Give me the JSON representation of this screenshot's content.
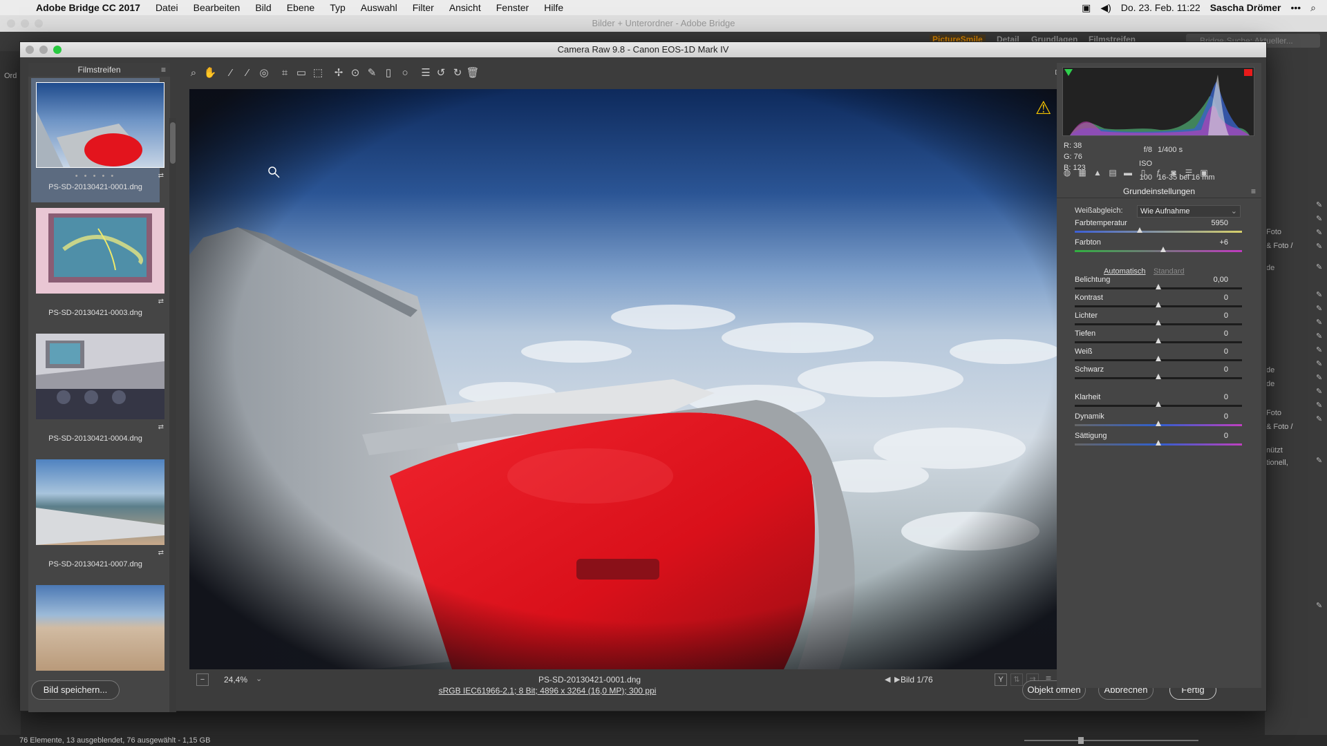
{
  "menubar": {
    "app_name": "Adobe Bridge CC 2017",
    "items": [
      "Datei",
      "Bearbeiten",
      "Bild",
      "Ebene",
      "Typ",
      "Auswahl",
      "Filter",
      "Ansicht",
      "Fenster",
      "Hilfe"
    ],
    "datetime": "Do. 23. Feb. 11:22",
    "user": "Sascha Drömer"
  },
  "bridge": {
    "window_title": "Bilder + Unterordner - Adobe Bridge",
    "workspaces": [
      "PictureSmile",
      "Detail",
      "Grundlagen",
      "Filmstreifen"
    ],
    "search_placeholder": "Bridge-Suche: Aktueller...",
    "left_panel_label": "Ord",
    "right_fragments": [
      "Foto",
      "& Foto /",
      "de",
      "de",
      "de",
      "Foto",
      "& Foto /",
      "nützt",
      "tionell,"
    ],
    "status": "76 Elemente, 13 ausgeblendet, 76 ausgewählt - 1,15 GB"
  },
  "dialog": {
    "title": "Camera Raw 9.8 - Canon EOS-1D Mark IV",
    "filmstrip": {
      "title": "Filmstreifen",
      "items": [
        {
          "name": "PS-SD-20130421-0001.dng",
          "dots": "• • • • •"
        },
        {
          "name": "PS-SD-20130421-0003.dng"
        },
        {
          "name": "PS-SD-20130421-0004.dng"
        },
        {
          "name": "PS-SD-20130421-0007.dng"
        },
        {
          "name": ""
        }
      ]
    },
    "preview": {
      "zoom": "24,4%",
      "filename": "PS-SD-20130421-0001.dng",
      "nav": "Bild 1/76"
    },
    "info_link": "sRGB IEC61966-2.1; 8 Bit; 4896 x 3264 (16,0 MP); 300 ppi",
    "buttons": {
      "save": "Bild speichern...",
      "open": "Objekt öffnen",
      "cancel": "Abbrechen",
      "done": "Fertig"
    },
    "readout": {
      "r": "R:  38",
      "g": "G:  76",
      "b": "B:  123",
      "aperture": "f/8",
      "shutter": "1/400 s",
      "iso": "ISO 100",
      "lens": "16-35 bei 16 mm"
    },
    "panel": {
      "title": "Grundeinstellungen",
      "wb_label": "Weißabgleich:",
      "wb_value": "Wie Aufnahme",
      "auto": "Automatisch",
      "standard": "Standard",
      "sliders": [
        {
          "label": "Farbtemperatur",
          "value": "5950",
          "pos": 0.39
        },
        {
          "label": "Farbton",
          "value": "+6",
          "pos": 0.53
        },
        {
          "label": "Belichtung",
          "value": "0,00",
          "pos": 0.5
        },
        {
          "label": "Kontrast",
          "value": "0",
          "pos": 0.5
        },
        {
          "label": "Lichter",
          "value": "0",
          "pos": 0.5
        },
        {
          "label": "Tiefen",
          "value": "0",
          "pos": 0.5
        },
        {
          "label": "Weiß",
          "value": "0",
          "pos": 0.5
        },
        {
          "label": "Schwarz",
          "value": "0",
          "pos": 0.5
        },
        {
          "label": "Klarheit",
          "value": "0",
          "pos": 0.5
        },
        {
          "label": "Dynamik",
          "value": "0",
          "pos": 0.5
        },
        {
          "label": "Sättigung",
          "value": "0",
          "pos": 0.5
        }
      ]
    }
  }
}
